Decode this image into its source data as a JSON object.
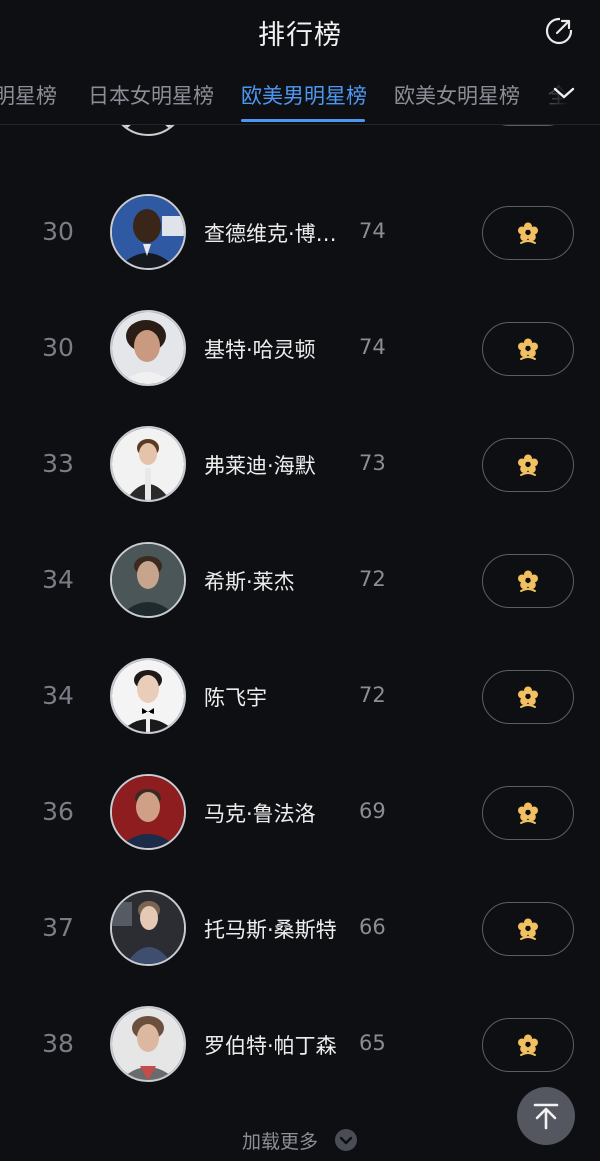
{
  "header": {
    "title": "排行榜"
  },
  "tabs": [
    {
      "label": "明星榜",
      "active": false
    },
    {
      "label": "日本女明星榜",
      "active": false
    },
    {
      "label": "欧美男明星榜",
      "active": true
    },
    {
      "label": "欧美女明星榜",
      "active": false
    },
    {
      "label": "全球",
      "active": false
    }
  ],
  "rows": [
    {
      "rank": "30",
      "name": "",
      "score": ""
    },
    {
      "rank": "30",
      "name": "查德维克·博…",
      "score": "74"
    },
    {
      "rank": "30",
      "name": "基特·哈灵顿",
      "score": "74"
    },
    {
      "rank": "33",
      "name": "弗莱迪·海默",
      "score": "73"
    },
    {
      "rank": "34",
      "name": "希斯·莱杰",
      "score": "72"
    },
    {
      "rank": "34",
      "name": "陈飞宇",
      "score": "72"
    },
    {
      "rank": "36",
      "name": "马克·鲁法洛",
      "score": "69"
    },
    {
      "rank": "37",
      "name": "托马斯·桑斯特",
      "score": "66"
    },
    {
      "rank": "38",
      "name": "罗伯特·帕丁森",
      "score": "65"
    }
  ],
  "load_more": "加载更多",
  "colors": {
    "accent": "#4d97f0",
    "background": "#0e0f12",
    "flower": "#f2c061"
  }
}
